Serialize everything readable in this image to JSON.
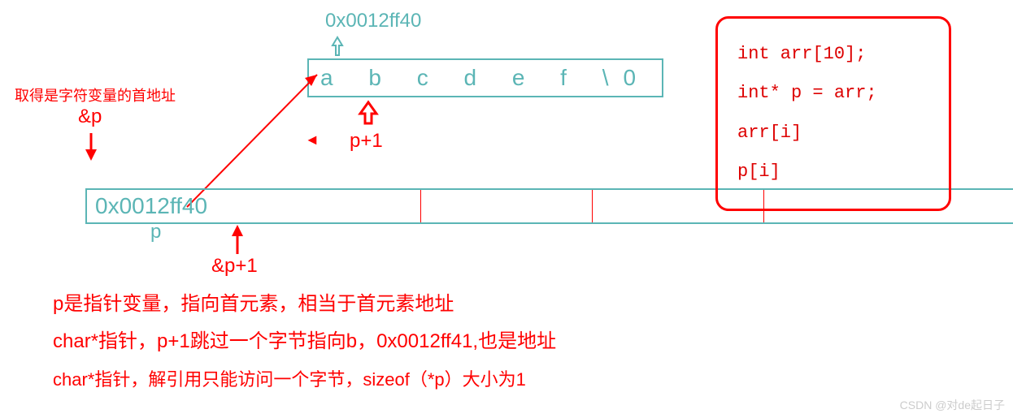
{
  "topAddress": "0x0012ff40",
  "arrayCells": "a   b   c   d   e   f   \\0",
  "pointerBoxValue": "0x0012ff40",
  "pointerLabel": "p",
  "ampP": "&p",
  "ampPDesc": "取得是字符变量的首地址",
  "pPlus1": "p+1",
  "ampPplus1": "&p+1",
  "notes": {
    "line1": "p是指针变量，指向首元素，相当于首元素地址",
    "line2": "char*指针，p+1跳过一个字节指向b，0x0012ff41,也是地址",
    "line3": "char*指针，解引用只能访问一个字节，sizeof（*p）大小为1"
  },
  "code": {
    "l1": "int arr[10];",
    "l2": "int* p = arr;",
    "l3": "arr[i]",
    "l4": "p[i]"
  },
  "watermark": "CSDN @对de起日子",
  "arrowLeft": "◄"
}
